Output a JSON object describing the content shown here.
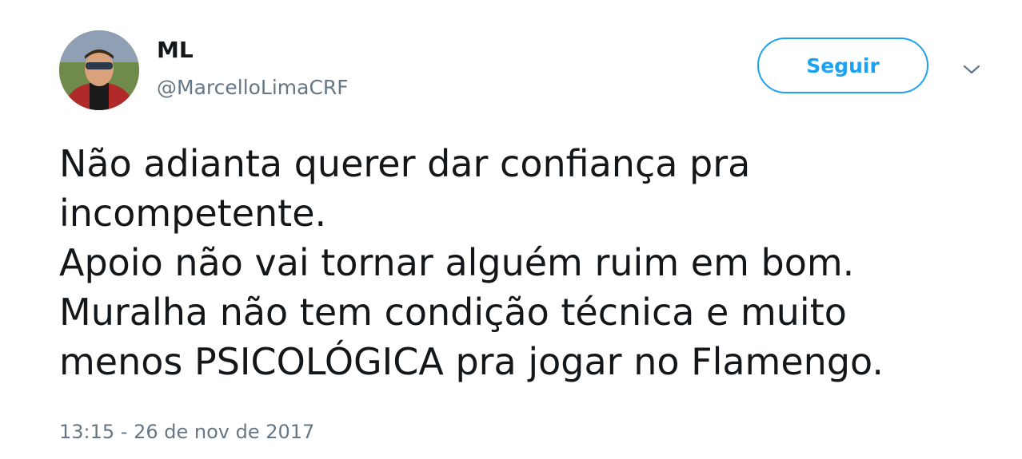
{
  "user": {
    "display_name": "ML",
    "handle": "@MarcelloLimaCRF",
    "avatar_icon": "profile-photo"
  },
  "follow_button": {
    "label": "Seguir"
  },
  "menu": {
    "icon": "chevron-down-icon"
  },
  "tweet": {
    "text": "Não adianta querer dar confiança pra\nincompetente.\nApoio não vai tornar alguém ruim em bom.\nMuralha não tem condição técnica e muito\nmenos PSICOLÓGICA pra jogar no Flamengo.",
    "timestamp": "13:15 - 26 de nov de 2017"
  },
  "colors": {
    "accent": "#1da1f2",
    "text": "#14171a",
    "secondary_text": "#657786"
  }
}
